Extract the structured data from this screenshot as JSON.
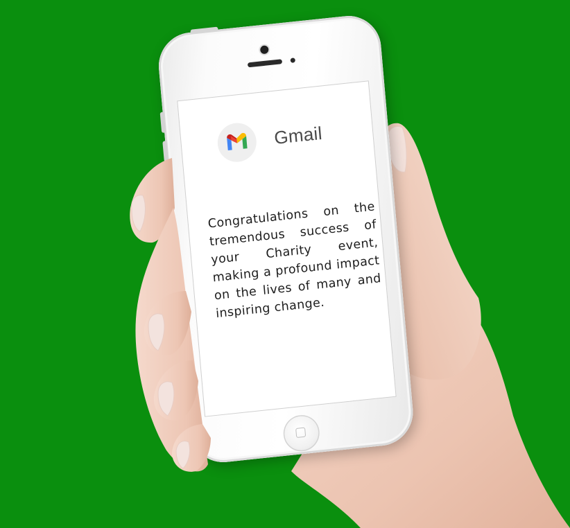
{
  "background_color": "#0a8f0e",
  "app": {
    "name": "Gmail",
    "logo_icon": "gmail-logo-icon"
  },
  "message": {
    "text": "Congratulations on the tremendous success of your Charity event, making a profound impact on the lives of many and inspiring change."
  },
  "colors": {
    "gmail_red": "#ea4335",
    "gmail_blue": "#4285f4",
    "gmail_green": "#34a853",
    "gmail_yellow": "#fbbc04",
    "gmail_dark_red": "#c5221f"
  }
}
